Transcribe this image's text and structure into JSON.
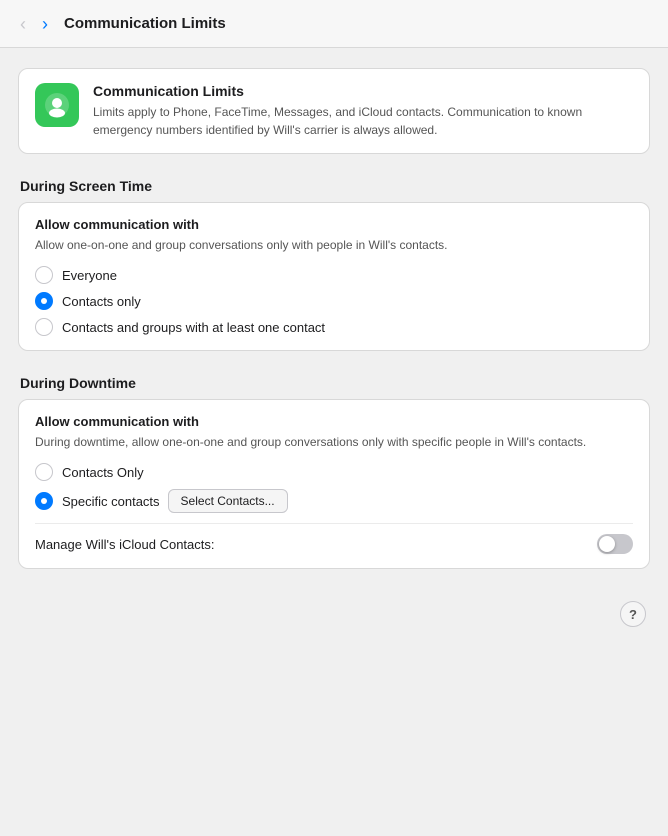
{
  "header": {
    "title": "Communication Limits",
    "back_label": "‹",
    "forward_label": "›"
  },
  "info_card": {
    "icon_alt": "Communication Limits icon",
    "title": "Communication Limits",
    "description": "Limits apply to Phone, FaceTime, Messages, and iCloud contacts. Communication to known emergency numbers identified by Will's carrier is always allowed."
  },
  "screen_time_section": {
    "title": "During Screen Time",
    "card_title": "Allow communication with",
    "card_subtitle": "Allow one-on-one and group conversations only with people in Will's contacts.",
    "options": [
      {
        "label": "Everyone",
        "selected": false
      },
      {
        "label": "Contacts only",
        "selected": true
      },
      {
        "label": "Contacts and groups with at least one contact",
        "selected": false
      }
    ]
  },
  "downtime_section": {
    "title": "During Downtime",
    "card_title": "Allow communication with",
    "card_subtitle": "During downtime, allow one-on-one and group conversations only with specific people in Will's contacts.",
    "options": [
      {
        "label": "Contacts Only",
        "selected": false
      },
      {
        "label": "Specific contacts",
        "selected": true
      }
    ],
    "select_contacts_button": "Select Contacts...",
    "manage_row": {
      "label": "Manage Will's iCloud Contacts:",
      "toggle_on": false
    }
  },
  "help_button": "?"
}
